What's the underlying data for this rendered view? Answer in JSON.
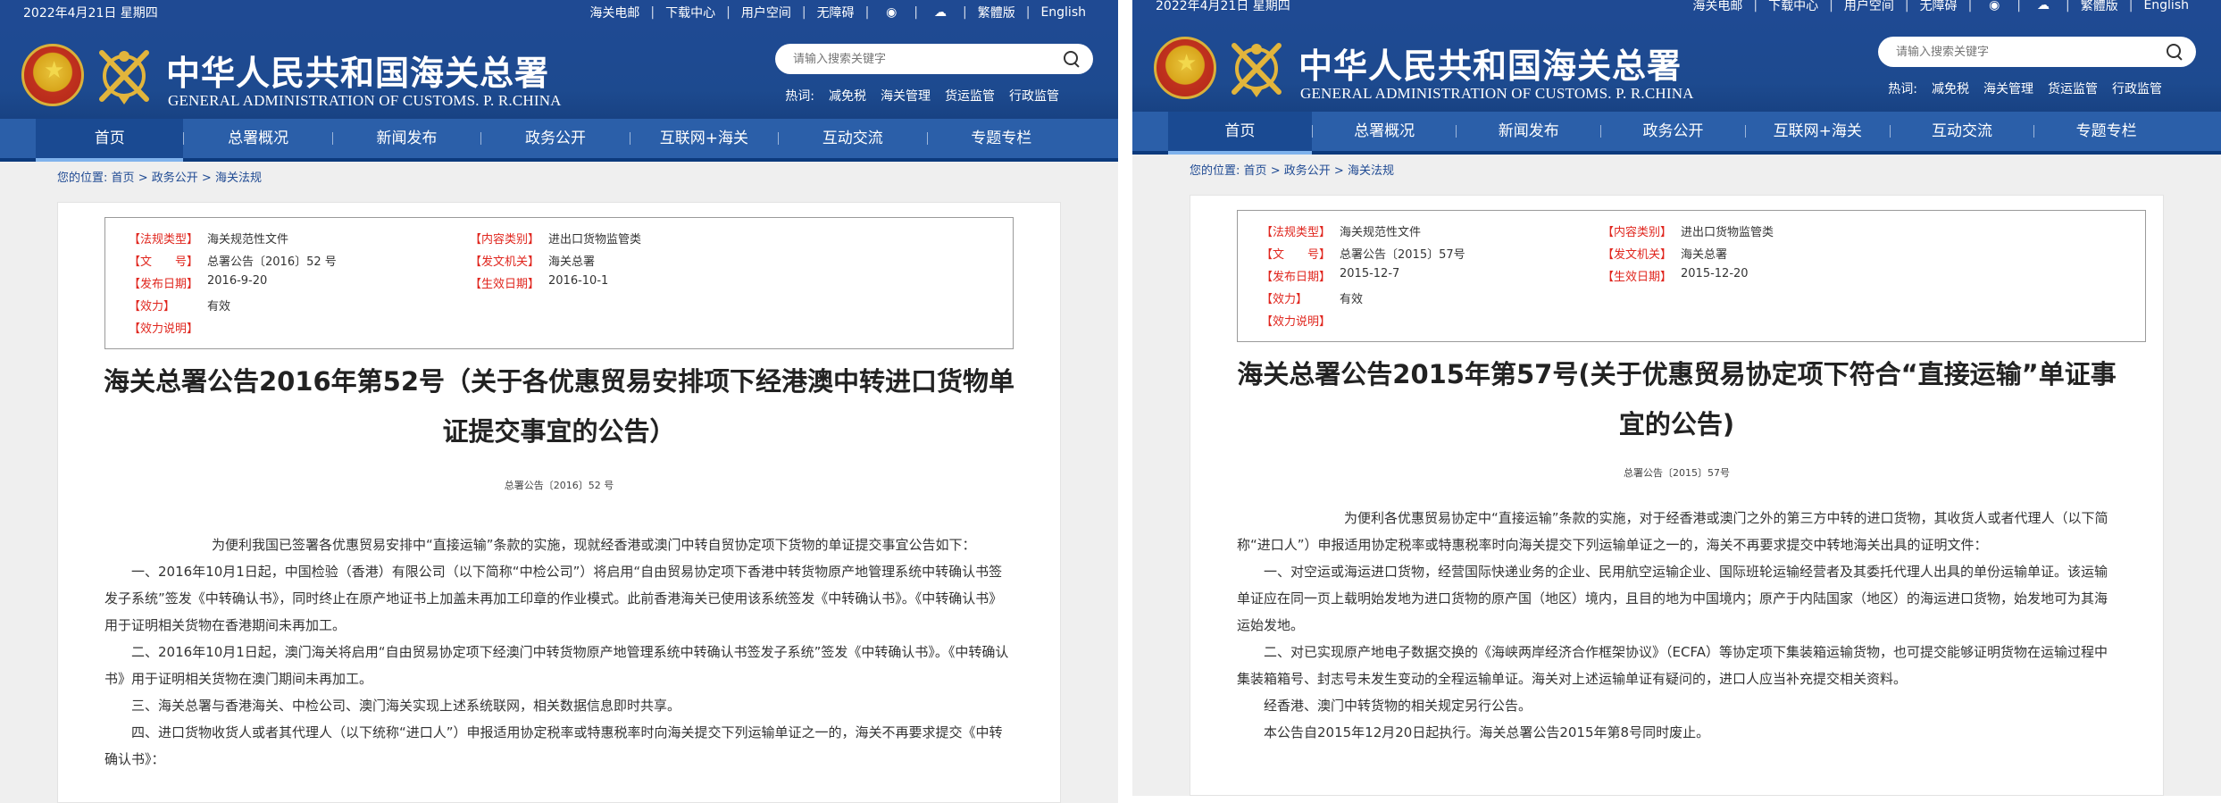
{
  "topbar": {
    "date": "2022年4月21日 星期四",
    "links": [
      "海关电邮",
      "下载中心",
      "用户空间",
      "无障碍"
    ],
    "icons": [
      "weibo-icon",
      "wechat-icon"
    ],
    "lang": [
      "繁體版",
      "English"
    ]
  },
  "header": {
    "title_cn": "中华人民共和国海关总署",
    "title_en": "GENERAL ADMINISTRATION OF CUSTOMS. P. R.CHINA",
    "search_placeholder": "请输入搜索关键字",
    "hot_label": "热词:",
    "hot_words": [
      "减免税",
      "海关管理",
      "货运监管",
      "行政监管"
    ]
  },
  "nav": [
    "首页",
    "总署概况",
    "新闻发布",
    "政务公开",
    "互联网+海关",
    "互动交流",
    "专题专栏"
  ],
  "breadcrumb": {
    "prefix": "您的位置:",
    "items": [
      "首页",
      "政务公开",
      "海关法规"
    ],
    "sep": ">"
  },
  "meta_labels": {
    "law_type": "【法规类型】",
    "content_type": "【内容类别】",
    "doc_no": "【文　　号】",
    "issuer": "【发文机关】",
    "pub_date": "【发布日期】",
    "eff_date": "【生效日期】",
    "status": "【效力】",
    "status_note": "【效力说明】"
  },
  "left": {
    "meta": {
      "law_type": "海关规范性文件",
      "content_type": "进出口货物监管类",
      "doc_no": "总署公告〔2016〕52 号",
      "issuer": "海关总署",
      "pub_date": "2016-9-20",
      "eff_date": "2016-10-1",
      "status": "有效",
      "status_note": ""
    },
    "title": "海关总署公告2016年第52号（关于各优惠贸易安排项下经港澳中转进口货物单证提交事宜的公告）",
    "docno": "总署公告〔2016〕52 号",
    "paragraphs": [
      "为便利我国已签署各优惠贸易安排中“直接运输”条款的实施，现就经香港或澳门中转自贸协定项下货物的单证提交事宜公告如下：",
      "一、2016年10月1日起，中国检验（香港）有限公司（以下简称“中检公司”）将启用“自由贸易协定项下香港中转货物原产地管理系统中转确认书签发子系统”签发《中转确认书》，同时终止在原产地证书上加盖未再加工印章的作业模式。此前香港海关已使用该系统签发《中转确认书》。《中转确认书》用于证明相关货物在香港期间未再加工。",
      "二、2016年10月1日起，澳门海关将启用“自由贸易协定项下经澳门中转货物原产地管理系统中转确认书签发子系统”签发《中转确认书》。《中转确认书》用于证明相关货物在澳门期间未再加工。",
      "三、海关总署与香港海关、中检公司、澳门海关实现上述系统联网，相关数据信息即时共享。",
      "四、进口货物收货人或者其代理人（以下统称“进口人”）申报适用协定税率或特惠税率时向海关提交下列运输单证之一的，海关不再要求提交《中转确认书》："
    ]
  },
  "right": {
    "meta": {
      "law_type": "海关规范性文件",
      "content_type": "进出口货物监管类",
      "doc_no": "总署公告〔2015〕57号",
      "issuer": "海关总署",
      "pub_date": "2015-12-7",
      "eff_date": "2015-12-20",
      "status": "有效",
      "status_note": ""
    },
    "title": "海关总署公告2015年第57号(关于优惠贸易协定项下符合“直接运输”单证事宜的公告)",
    "docno": "总署公告〔2015〕57号",
    "paragraphs": [
      "为便利各优惠贸易协定中“直接运输”条款的实施，对于经香港或澳门之外的第三方中转的进口货物，其收货人或者代理人（以下简称“进口人”）申报适用协定税率或特惠税率时向海关提交下列运输单证之一的，海关不再要求提交中转地海关出具的证明文件：",
      "一、对空运或海运进口货物，经营国际快递业务的企业、民用航空运输企业、国际班轮运输经营者及其委托代理人出具的单份运输单证。该运输单证应在同一页上载明始发地为进口货物的原产国（地区）境内，且目的地为中国境内；原产于内陆国家（地区）的海运进口货物，始发地可为其海运始发地。",
      "二、对已实现原产地电子数据交换的《海峡两岸经济合作框架协议》（ECFA）等协定项下集装箱运输货物，也可提交能够证明货物在运输过程中集装箱箱号、封志号未发生变动的全程运输单证。海关对上述运输单证有疑问的，进口人应当补充提交相关资料。",
      "经香港、澳门中转货物的相关规定另行公告。",
      "本公告自2015年12月20日起执行。海关总署公告2015年第8号同时废止。"
    ]
  }
}
